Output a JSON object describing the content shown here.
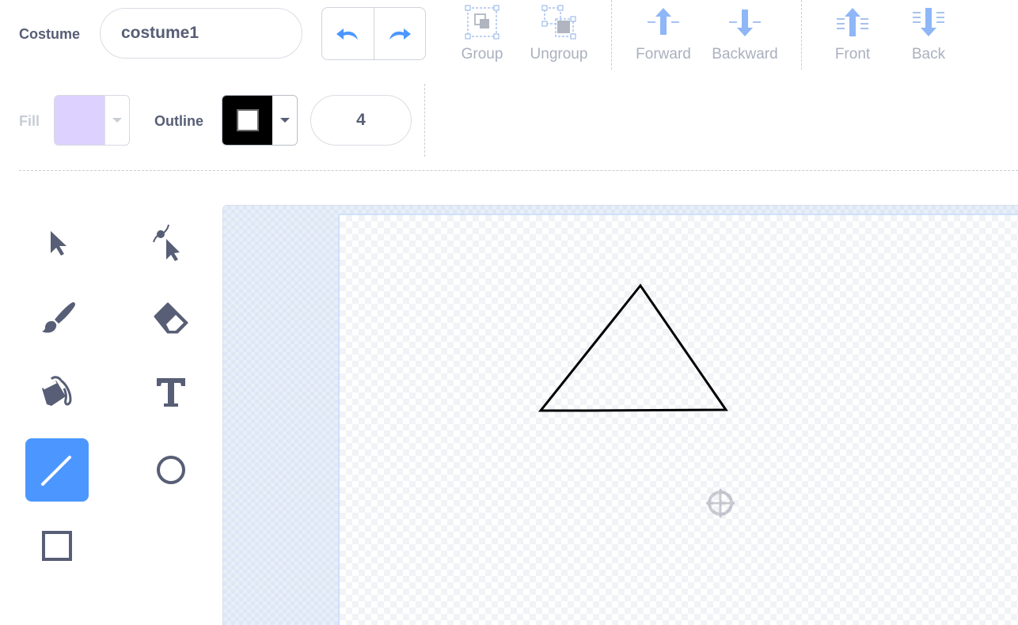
{
  "costume": {
    "label": "Costume",
    "name": "costume1"
  },
  "toolbar": {
    "undo_icon": "undo-icon",
    "redo_icon": "redo-icon",
    "group_label": "Group",
    "ungroup_label": "Ungroup",
    "forward_label": "Forward",
    "backward_label": "Backward",
    "front_label": "Front",
    "back_label": "Back"
  },
  "style": {
    "fill_label": "Fill",
    "fill_color": "#ddd1ff",
    "outline_label": "Outline",
    "outline_color": "#000000",
    "outline_width": "4"
  },
  "tools": [
    {
      "name": "select",
      "icon": "arrow-cursor-icon",
      "selected": false
    },
    {
      "name": "reshape",
      "icon": "reshape-icon",
      "selected": false
    },
    {
      "name": "brush",
      "icon": "brush-icon",
      "selected": false
    },
    {
      "name": "eraser",
      "icon": "eraser-icon",
      "selected": false
    },
    {
      "name": "fill",
      "icon": "paint-bucket-icon",
      "selected": false
    },
    {
      "name": "text",
      "icon": "text-icon",
      "selected": false
    },
    {
      "name": "line",
      "icon": "line-icon",
      "selected": true
    },
    {
      "name": "circle",
      "icon": "circle-icon",
      "selected": false
    },
    {
      "name": "rectangle",
      "icon": "rectangle-icon",
      "selected": false
    }
  ],
  "colors": {
    "accent": "#4c97ff",
    "text": "#575e75",
    "disabled": "#aab0bd"
  }
}
